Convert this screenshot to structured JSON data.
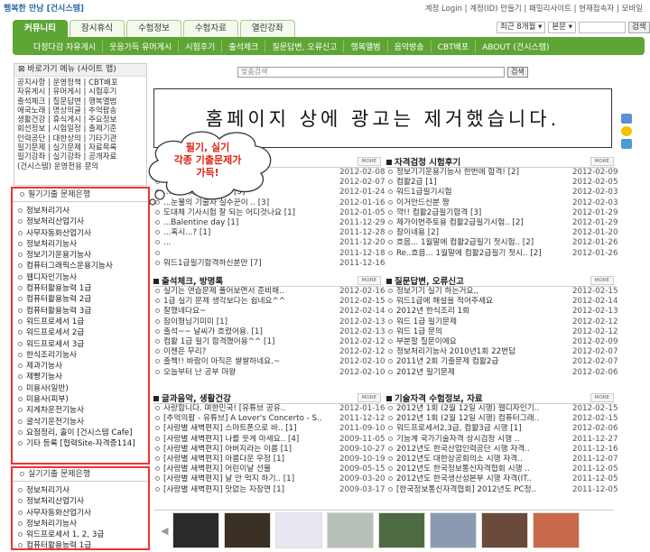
{
  "top": {
    "logo": "행복한 만남 [건시스템]",
    "links": "계정 Login | 계정(ID) 만들기 | 패밀리사이트 | 현재접속자 | 모바일"
  },
  "tabs": [
    {
      "label": "커뮤니티",
      "active": true
    },
    {
      "label": "잠시휴식",
      "active": false
    },
    {
      "label": "수험정보",
      "active": false
    },
    {
      "label": "수험자료",
      "active": false
    },
    {
      "label": "열린강좌",
      "active": false
    }
  ],
  "search": {
    "period": "최근 8개월",
    "field": "본문",
    "button": "검색"
  },
  "subnav": [
    "다정다감 자유게시",
    "웃음가득 유머게시",
    "시험후기",
    "출석체크",
    "질문답변, 오류신고",
    "행복앨범",
    "음악방송",
    "CBT배포",
    "ABOUT (건시스템)"
  ],
  "quick_menu": {
    "title": "바로가기 메뉴 (사이트 맵)",
    "lines": [
      "공지사항 | 운영정책 | CBT배포",
      "자유게시 | 유머게시 | 시험후기",
      "출석체크 | 질문답변 | 행복앨범",
      "애국노래 | 명상의글 | 추억팝송",
      "생활건강 | 휴식게시 | 주요정보",
      "회선정보 | 시험일정 | 출제기준",
      "인력공단 | 대한상의 | 기타기관",
      "필기문제 | 실기문제 | 자료목록",
      "필기강좌 | 실기강좌 | 공개자료",
      "(건시스템) 운영전용 문의"
    ]
  },
  "bank_written": {
    "title": "필기기출 문제은행",
    "items": [
      "정보처리기사",
      "정보처리산업기사",
      "사무자동화산업기사",
      "정보처리기능사",
      "정보기기운용기능사",
      "컴퓨터그래픽스운용기능사",
      "웹디자인기능사",
      "컴퓨터활용능력 1급",
      "컴퓨터활용능력 2급",
      "컴퓨터활용능력 3급",
      "워드프로세서 1급",
      "워드프로세서 2급",
      "워드프로세서 3급",
      "한식조리기능사",
      "제과기능사",
      "제빵기능사",
      "미용사(일반)",
      "미용사(피부)",
      "지게차운전기능사",
      "굴삭기운전기능사",
      "요점정리, 홀이 [건시스템 Cafe]",
      "기타 등록 [협력Site-자격증114]"
    ]
  },
  "bank_practical": {
    "title": "실기기출 문제은행",
    "items": [
      "정보처리기사",
      "정보처리산업기사",
      "사무자동화산업기사",
      "정보처리기능사",
      "워드프로세서 1, 2, 3급",
      "컴퓨터활용능력 1급"
    ]
  },
  "google_search": {
    "placeholder": "맞춤검색",
    "button": "검색"
  },
  "ad_banner": "홈페이지 상에 광고는 제거했습니다.",
  "bubble": {
    "line1": "필기, 실기",
    "line2": "각종 기출문제가",
    "line3": "가득!"
  },
  "panels": [
    {
      "title": "",
      "more": "MORE",
      "rows": [
        {
          "t": "",
          "d": "2012-02-08"
        },
        {
          "t": "",
          "d": "2012-02-07"
        },
        {
          "t": "...생애 첫 마라톤,,ㅋ [3]",
          "d": "2012-01-24"
        },
        {
          "t": "...눈물의 기술자 실수꾼이 .. [3]",
          "d": "2012-01-16"
        },
        {
          "t": "도대체 기사시험 잘 되는 어디것나요 [1]",
          "d": "2012-01-05"
        },
        {
          "t": "...Balentine day [1]",
          "d": "2011-12-29"
        },
        {
          "t": "...혹시...? [1]",
          "d": "2011-12-28"
        },
        {
          "t": "...",
          "d": "2011-12-20"
        },
        {
          "t": "",
          "d": "2011-12-18"
        },
        {
          "t": "워드1급필기합격하신분만 [7]",
          "d": "2011-12-16"
        }
      ]
    },
    {
      "title": "자격검정 시험후기",
      "more": "MORE",
      "rows": [
        {
          "t": "정보기기운용기능사 한번에 합격! [2]",
          "d": "2012-02-09"
        },
        {
          "t": "컴활2급 [1]",
          "d": "2012-02-05"
        },
        {
          "t": "워드1급필기시험",
          "d": "2012-02-03"
        },
        {
          "t": "이거만드신분 짱",
          "d": "2012-02-03"
        },
        {
          "t": "꺅!! 컴활2급필기합격 [3]",
          "d": "2012-01-29"
        },
        {
          "t": "제가이번주토용 컴활2급필기시험.. [2]",
          "d": "2012-01-29"
        },
        {
          "t": "참이네용 [2]",
          "d": "2012-01-20"
        },
        {
          "t": "흐음... 1월말에 컴활2급필기 첫시험.. [2]",
          "d": "2012-01-26"
        },
        {
          "t": "Re..흐음... 1월말에 컴활2급필기 첫시.. [2]",
          "d": "2012-01-26"
        }
      ]
    },
    {
      "title": "출석체크, 방명록",
      "more": "MORE",
      "rows": [
        {
          "t": "실기는 연습문제 풀어보면서 준비해..",
          "d": "2012-02-16"
        },
        {
          "t": "1급 실기 문제 생각보다는 쉽네요^^",
          "d": "2012-02-15"
        },
        {
          "t": "잘했네다요~",
          "d": "2012-02-14"
        },
        {
          "t": "잠이형님기미미 [1]",
          "d": "2012-02-13"
        },
        {
          "t": "출석~~ 날씨가 흐렸어용. [1]",
          "d": "2012-02-13"
        },
        {
          "t": "컴활 1급 필기 합격했어용^^ [1]",
          "d": "2012-02-12"
        },
        {
          "t": "이젠은 무리?",
          "d": "2012-02-12"
        },
        {
          "t": "출첵!! 바람이 아직은 쌀쌀하네요.~",
          "d": "2012-02-10"
        },
        {
          "t": "오늘부터 난 공부 마왕",
          "d": "2012-02-10"
        }
      ]
    },
    {
      "title": "질문답변, 오류신고",
      "more": "MORE",
      "rows": [
        {
          "t": "정보기기 실기 하는거요,,",
          "d": "2012-02-15"
        },
        {
          "t": "워드1급에 해설을 적어주세요",
          "d": "2012-02-14"
        },
        {
          "t": "2012년 한식조리 1회",
          "d": "2012-02-13"
        },
        {
          "t": "워드 1급 필기문제",
          "d": "2012-02-12"
        },
        {
          "t": "워드 1급 문의",
          "d": "2012-02-12"
        },
        {
          "t": "부분할 질문이에요",
          "d": "2012-02-09"
        },
        {
          "t": "정보처리기능사 2010년1회 22번답",
          "d": "2012-02-07"
        },
        {
          "t": "2011년 2회 기출문제 컴활2급",
          "d": "2012-02-07"
        },
        {
          "t": "2012년 필기문제",
          "d": "2012-02-06"
        }
      ]
    },
    {
      "title": "글과음악, 생활건강",
      "more": "MORE",
      "rows": [
        {
          "t": "사랑합니다. 며한민국! [유튜브 공유..",
          "d": "2012-01-16"
        },
        {
          "t": "[추억의팝 - 유튜브] A Lover's Concerto - S..",
          "d": "2011-12-12"
        },
        {
          "t": "[사랑별 새벽편지] 스마트폰으로 바.. [1]",
          "d": "2011-09-10"
        },
        {
          "t": "[사랑별 새벽편지] 나를 웃게 마세요.. [4]",
          "d": "2009-11-05"
        },
        {
          "t": "[사랑별 새벽편지] 아버지라는 이름 [1]",
          "d": "2009-10-27"
        },
        {
          "t": "[사랑별 새벽편지] 아름다운 우정 [1]",
          "d": "2009-10-19"
        },
        {
          "t": "[사랑별 새벽편지] 어린이날 선물",
          "d": "2009-05-15"
        },
        {
          "t": "[사랑별 새벽편지] 날 안 먹지 하기.. [1]",
          "d": "2009-03-20"
        },
        {
          "t": "[사랑별 새벽편지] 맛없는 자장면 [1]",
          "d": "2009-03-17"
        }
      ]
    },
    {
      "title": "기술자격 수험정보, 자료",
      "more": "MORE",
      "rows": [
        {
          "t": "2012년 1회 (2월 12일 시행) 웹디자인기..",
          "d": "2012-02-15"
        },
        {
          "t": "2012년 1회 (2월 12일 시행) 컴퓨터그래..",
          "d": "2012-02-15"
        },
        {
          "t": "워드프로세서2,3급, 컴활3급 시행 [1]",
          "d": "2012-02-06"
        },
        {
          "t": "기능계 국가기술자격 상시검정 시행 ..",
          "d": "2011-12-27"
        },
        {
          "t": "2012년도 한국산업인력공단 시행 자격..",
          "d": "2011-12-16"
        },
        {
          "t": "2012년도 대한상공회의소 시행 자격..",
          "d": "2011-12-07"
        },
        {
          "t": "2012년도 한국정보통신자격협회 시행 ..",
          "d": "2011-12-05"
        },
        {
          "t": "2012년도 한국생산성본부 시행 자격(IT..",
          "d": "2011-12-05"
        },
        {
          "t": "[한국정보통신자격협회] 2012년도 PC정..",
          "d": "2011-12-05"
        }
      ]
    }
  ],
  "colors": {
    "accent": "#5ea536",
    "highlight_box": "#e33333"
  }
}
